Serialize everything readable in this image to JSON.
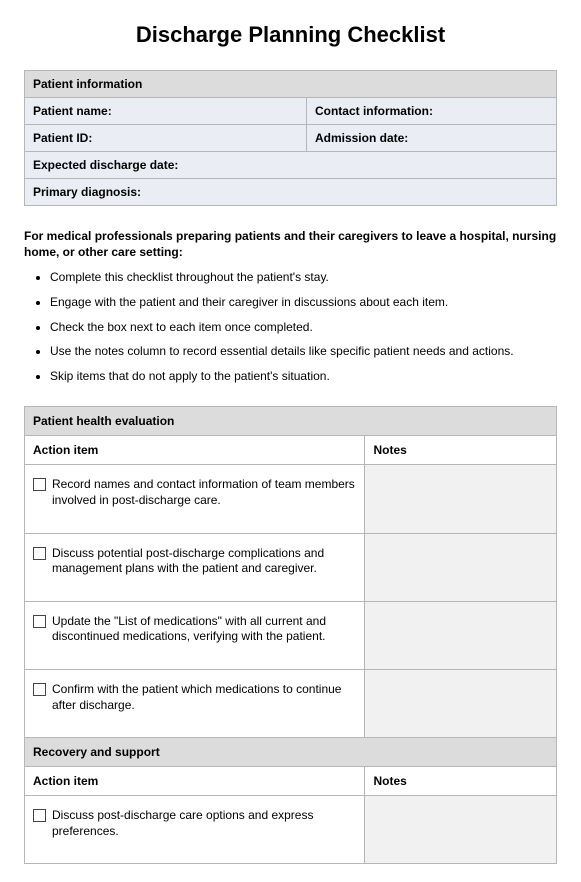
{
  "title": "Discharge Planning Checklist",
  "patient_info": {
    "header": "Patient information",
    "fields": {
      "name_label": "Patient name:",
      "contact_label": "Contact information:",
      "id_label": "Patient ID:",
      "admission_label": "Admission date:",
      "discharge_label": "Expected discharge date:",
      "diagnosis_label": "Primary diagnosis:"
    }
  },
  "intro": "For medical professionals preparing patients and their caregivers to leave a hospital, nursing home, or other care setting:",
  "instructions": [
    "Complete this checklist throughout the patient's stay.",
    "Engage with the patient and their caregiver in discussions about each item.",
    "Check the box next to each item once completed.",
    "Use the notes column to record essential details like specific patient needs and actions.",
    "Skip items that do not apply to the patient's situation."
  ],
  "columns": {
    "action": "Action item",
    "notes": "Notes"
  },
  "sections": [
    {
      "header": "Patient health evaluation",
      "items": [
        "Record names and contact information of team members involved in post-discharge care.",
        "Discuss potential post-discharge complications and management plans with the patient and caregiver.",
        "Update the \"List of medications\" with all current and discontinued medications, verifying with the patient.",
        "Confirm with the patient which medications to continue after discharge."
      ]
    },
    {
      "header": "Recovery and support",
      "items": [
        "Discuss post-discharge care options and express preferences."
      ]
    }
  ]
}
